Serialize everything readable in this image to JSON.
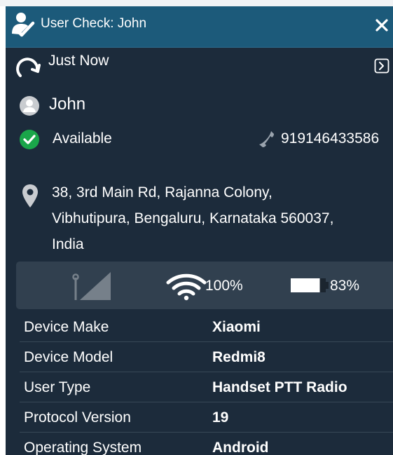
{
  "header": {
    "title": "User Check: John"
  },
  "refresh": {
    "label": "Just Now"
  },
  "user": {
    "name": "John",
    "status": "Available",
    "status_color": "#1aa64a",
    "phone": "919146433586"
  },
  "location": {
    "address_line1": "38, 3rd Main Rd, Rajanna Colony,",
    "address_line2": "Vibhutipura, Bengaluru, Karnataka 560037,",
    "address_line3": "India"
  },
  "device_status": {
    "signal_icon": "cellular-signal-icon",
    "wifi_icon": "wifi-icon",
    "wifi_level": "100%",
    "battery_icon": "battery-icon",
    "battery_level": "83%",
    "battery_fraction": 0.83
  },
  "info": [
    {
      "label": "Device Make",
      "value": "Xiaomi"
    },
    {
      "label": "Device Model",
      "value": "Redmi8"
    },
    {
      "label": "User Type",
      "value": "Handset PTT Radio"
    },
    {
      "label": "Protocol Version",
      "value": "19"
    },
    {
      "label": "Operating System",
      "value": "Android"
    }
  ],
  "colors": {
    "header_bg": "#1c5a7a",
    "panel_bg": "#1c2b3b",
    "device_bar_bg": "#31404f"
  }
}
